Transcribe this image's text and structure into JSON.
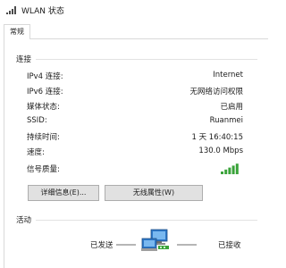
{
  "window": {
    "title": "WLAN 状态"
  },
  "tabs": [
    {
      "label": "常规"
    }
  ],
  "connection": {
    "section_title": "连接",
    "rows": [
      {
        "label": "IPv4 连接:",
        "value": "Internet"
      },
      {
        "label": "IPv6 连接:",
        "value": "无网络访问权限"
      },
      {
        "label": "媒体状态:",
        "value": "已启用"
      },
      {
        "label": "SSID:",
        "value": "Ruanmei"
      },
      {
        "label": "持续时间:",
        "value": "1 天 16:40:15"
      },
      {
        "label": "速度:",
        "value": "130.0 Mbps"
      }
    ],
    "signal_label": "信号质量:",
    "signal_icon": "signal-strength-icon",
    "signal_bars_lit": 5,
    "signal_bars_total": 5,
    "signal_color": "#3aa33a"
  },
  "buttons": {
    "details": "详细信息(E)...",
    "wireless_properties": "无线属性(W)"
  },
  "activity": {
    "section_title": "活动",
    "sent_label": "已发送",
    "received_label": "已接收",
    "network_icon": "network-computers-icon"
  }
}
